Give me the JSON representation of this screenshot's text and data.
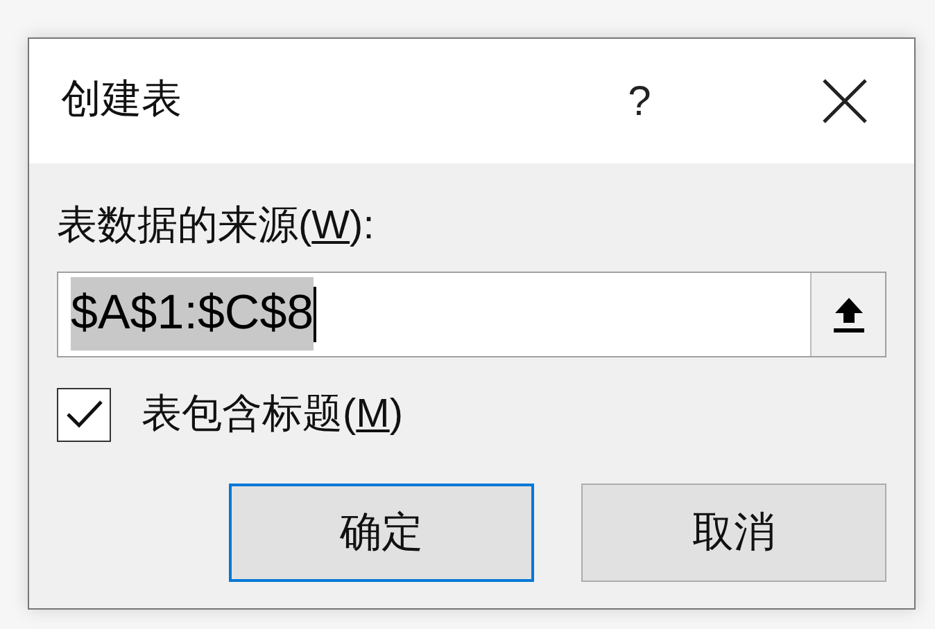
{
  "window": {
    "title": "创建表",
    "help": "?"
  },
  "source": {
    "label_before": "表数据的来源(",
    "access_key": "W",
    "label_after": "):",
    "value": "$A$1:$C$8",
    "value_selected": true
  },
  "header_option": {
    "label_before": "表包含标题(",
    "access_key": "M",
    "label_after": ")",
    "checked": true
  },
  "buttons": [
    {
      "label": "确定",
      "default": true
    },
    {
      "label": "取消",
      "default": false
    }
  ]
}
